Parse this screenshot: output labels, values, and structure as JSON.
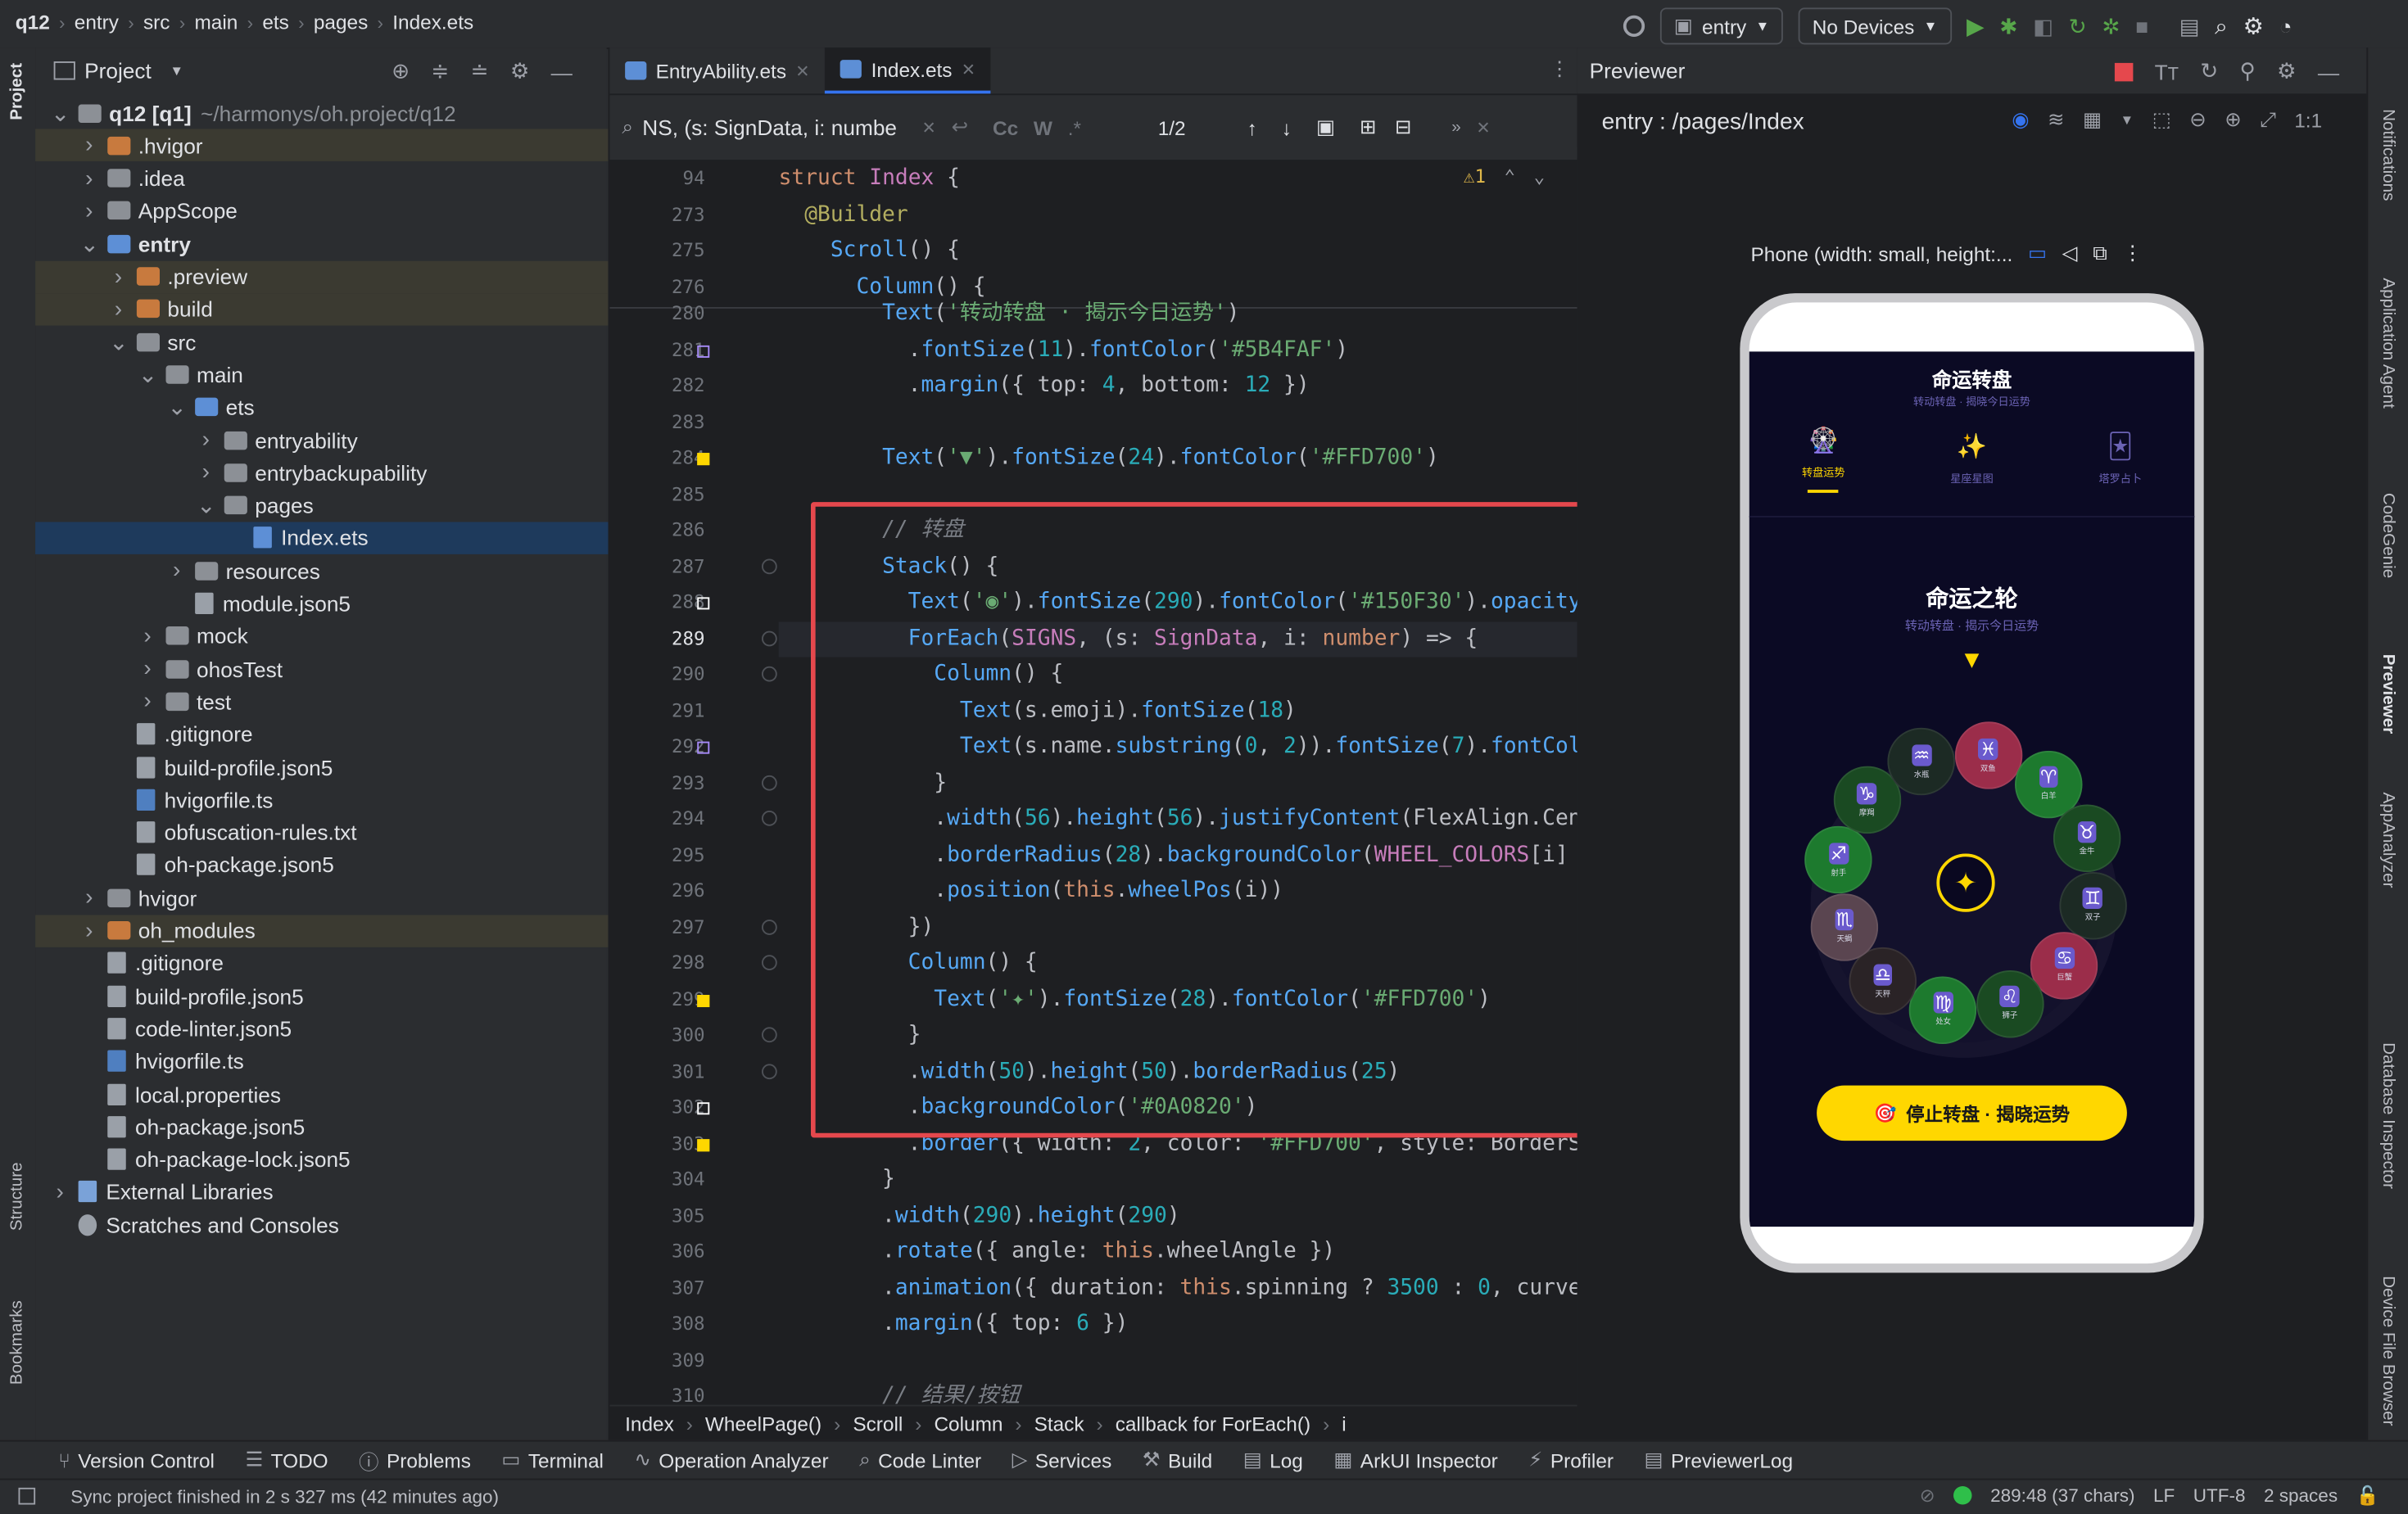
{
  "topbar": {
    "breadcrumbs": [
      "q12",
      "entry",
      "src",
      "main",
      "ets",
      "pages",
      "Index.ets"
    ],
    "run_config": "entry",
    "device": "No Devices"
  },
  "left_strip": {
    "project": "Project",
    "structure": "Structure",
    "bookmarks": "Bookmarks"
  },
  "right_strip": [
    "Notifications",
    "Application Agent",
    "CodeGenie",
    "Previewer",
    "AppAnalyzer",
    "Database Inspector",
    "Device File Browser"
  ],
  "project_panel": {
    "title": "Project",
    "tree": [
      {
        "label": "q12 [q1]",
        "suffix": "~/harmonys/oh.project/q12",
        "depth": 0,
        "kind": "root",
        "chev": "v"
      },
      {
        "label": ".hvigor",
        "depth": 1,
        "kind": "folder-orange",
        "chev": ">",
        "hl": true
      },
      {
        "label": ".idea",
        "depth": 1,
        "kind": "folder",
        "chev": ">"
      },
      {
        "label": "AppScope",
        "depth": 1,
        "kind": "folder",
        "chev": ">"
      },
      {
        "label": "entry",
        "depth": 1,
        "kind": "folder-blue",
        "chev": "v",
        "bold": true
      },
      {
        "label": ".preview",
        "depth": 2,
        "kind": "folder-orange",
        "chev": ">",
        "hl": true
      },
      {
        "label": "build",
        "depth": 2,
        "kind": "folder-orange",
        "chev": ">",
        "hl": true
      },
      {
        "label": "src",
        "depth": 2,
        "kind": "folder",
        "chev": "v"
      },
      {
        "label": "main",
        "depth": 3,
        "kind": "folder",
        "chev": "v"
      },
      {
        "label": "ets",
        "depth": 4,
        "kind": "folder-blue",
        "chev": "v"
      },
      {
        "label": "entryability",
        "depth": 5,
        "kind": "folder",
        "chev": ">"
      },
      {
        "label": "entrybackupability",
        "depth": 5,
        "kind": "folder",
        "chev": ">"
      },
      {
        "label": "pages",
        "depth": 5,
        "kind": "folder",
        "chev": "v"
      },
      {
        "label": "Index.ets",
        "depth": 6,
        "kind": "file-ets",
        "chev": "",
        "sel": true
      },
      {
        "label": "resources",
        "depth": 4,
        "kind": "folder",
        "chev": ">"
      },
      {
        "label": "module.json5",
        "depth": 4,
        "kind": "file",
        "chev": ""
      },
      {
        "label": "mock",
        "depth": 3,
        "kind": "folder",
        "chev": ">"
      },
      {
        "label": "ohosTest",
        "depth": 3,
        "kind": "folder",
        "chev": ">"
      },
      {
        "label": "test",
        "depth": 3,
        "kind": "folder",
        "chev": ">"
      },
      {
        "label": ".gitignore",
        "depth": 2,
        "kind": "file",
        "chev": ""
      },
      {
        "label": "build-profile.json5",
        "depth": 2,
        "kind": "file",
        "chev": ""
      },
      {
        "label": "hvigorfile.ts",
        "depth": 2,
        "kind": "file-ts",
        "chev": ""
      },
      {
        "label": "obfuscation-rules.txt",
        "depth": 2,
        "kind": "file",
        "chev": ""
      },
      {
        "label": "oh-package.json5",
        "depth": 2,
        "kind": "file",
        "chev": ""
      },
      {
        "label": "hvigor",
        "depth": 1,
        "kind": "folder",
        "chev": ">"
      },
      {
        "label": "oh_modules",
        "depth": 1,
        "kind": "folder-orange",
        "chev": ">",
        "hl": true
      },
      {
        "label": ".gitignore",
        "depth": 1,
        "kind": "file",
        "chev": ""
      },
      {
        "label": "build-profile.json5",
        "depth": 1,
        "kind": "file",
        "chev": ""
      },
      {
        "label": "code-linter.json5",
        "depth": 1,
        "kind": "file",
        "chev": ""
      },
      {
        "label": "hvigorfile.ts",
        "depth": 1,
        "kind": "file-ts",
        "chev": ""
      },
      {
        "label": "local.properties",
        "depth": 1,
        "kind": "file",
        "chev": ""
      },
      {
        "label": "oh-package.json5",
        "depth": 1,
        "kind": "file",
        "chev": ""
      },
      {
        "label": "oh-package-lock.json5",
        "depth": 1,
        "kind": "file",
        "chev": ""
      },
      {
        "label": "External Libraries",
        "depth": 0,
        "kind": "lib",
        "chev": ">"
      },
      {
        "label": "Scratches and Consoles",
        "depth": 0,
        "kind": "scratch",
        "chev": ""
      }
    ]
  },
  "editor": {
    "tabs": [
      {
        "label": "EntryAbility.ets",
        "active": false
      },
      {
        "label": "Index.ets",
        "active": true
      }
    ],
    "search": {
      "query": "NS, (s: SignData, i: numbe",
      "count": "1/2"
    },
    "warning_count": "1",
    "sticky_lines": [
      {
        "no": "94",
        "html": "<span class='kw'>struct</span> <span class='typ'>Index</span> {"
      },
      {
        "no": "273",
        "html": "  <span class='ann'>@Builder</span>"
      },
      {
        "no": "275",
        "html": "    <span class='fn'>Scroll</span>() {"
      },
      {
        "no": "276",
        "html": "      <span class='fn'>Column</span>() {"
      }
    ],
    "lines": [
      {
        "no": "280",
        "html": "        <span class='fn'>Text</span>(<span class='str'>'转动转盘 · 揭示今日运势'</span>)"
      },
      {
        "no": "281",
        "html": "          .<span class='fn'>fontSize</span>(<span class='num'>11</span>).<span class='fn'>fontColor</span>(<span class='str'>'#5B4FAF'</span>)"
      },
      {
        "no": "282",
        "html": "          .<span class='fn'>margin</span>({ top: <span class='num'>4</span>, bottom: <span class='num'>12</span> })"
      },
      {
        "no": "283",
        "html": ""
      },
      {
        "no": "284",
        "html": "        <span class='fn'>Text</span>(<span class='str'>'▼'</span>).<span class='fn'>fontSize</span>(<span class='num'>24</span>).<span class='fn'>fontColor</span>(<span class='str'>'#FFD700'</span>)"
      },
      {
        "no": "285",
        "html": ""
      },
      {
        "no": "286",
        "html": "        <span class='cmt'>// 转盘</span>"
      },
      {
        "no": "287",
        "html": "        <span class='fn'>Stack</span>() {"
      },
      {
        "no": "288",
        "html": "          <span class='fn'>Text</span>(<span class='str'>'◉'</span>).<span class='fn'>fontSize</span>(<span class='num'>290</span>).<span class='fn'>fontColor</span>(<span class='str'>'#150F30'</span>).<span class='fn'>opacity</span>("
      },
      {
        "no": "289",
        "html": "          <span class='fn'>ForEach</span>(<span class='prop'>SIGNS</span>, (s: <span class='typ'>SignData</span>, i: <span class='kw'>number</span>) => {"
      },
      {
        "no": "290",
        "html": "            <span class='fn'>Column</span>() {"
      },
      {
        "no": "291",
        "html": "              <span class='fn'>Text</span>(s.emoji).<span class='fn'>fontSize</span>(<span class='num'>18</span>)"
      },
      {
        "no": "292",
        "html": "              <span class='fn'>Text</span>(s.name.<span class='fn'>substring</span>(<span class='num'>0</span>, <span class='num'>2</span>)).<span class='fn'>fontSize</span>(<span class='num'>7</span>).<span class='fn'>fontCol</span>"
      },
      {
        "no": "293",
        "html": "            }"
      },
      {
        "no": "294",
        "html": "            .<span class='fn'>width</span>(<span class='num'>56</span>).<span class='fn'>height</span>(<span class='num'>56</span>).<span class='fn'>justifyContent</span>(FlexAlign.Cent"
      },
      {
        "no": "295",
        "html": "            .<span class='fn'>borderRadius</span>(<span class='num'>28</span>).<span class='fn'>backgroundColor</span>(<span class='prop'>WHEEL_COLORS</span>[i] -"
      },
      {
        "no": "296",
        "html": "            .<span class='fn'>position</span>(<span class='kw'>this</span>.<span class='fn'>wheelPos</span>(i))"
      },
      {
        "no": "297",
        "html": "          })"
      },
      {
        "no": "298",
        "html": "          <span class='fn'>Column</span>() {"
      },
      {
        "no": "299",
        "html": "            <span class='fn'>Text</span>(<span class='str'>'✦'</span>).<span class='fn'>fontSize</span>(<span class='num'>28</span>).<span class='fn'>fontColor</span>(<span class='str'>'#FFD700'</span>)"
      },
      {
        "no": "300",
        "html": "          }"
      },
      {
        "no": "301",
        "html": "          .<span class='fn'>width</span>(<span class='num'>50</span>).<span class='fn'>height</span>(<span class='num'>50</span>).<span class='fn'>borderRadius</span>(<span class='num'>25</span>)"
      },
      {
        "no": "302",
        "html": "          .<span class='fn'>backgroundColor</span>(<span class='str'>'#0A0820'</span>)"
      },
      {
        "no": "303",
        "html": "          .<span class='fn'>border</span>({ width: <span class='num'>2</span>, color: <span class='str'>'#FFD700'</span>, style: BorderSt"
      },
      {
        "no": "304",
        "html": "        }"
      },
      {
        "no": "305",
        "html": "        .<span class='fn'>width</span>(<span class='num'>290</span>).<span class='fn'>height</span>(<span class='num'>290</span>)"
      },
      {
        "no": "306",
        "html": "        .<span class='fn'>rotate</span>({ angle: <span class='kw'>this</span>.wheelAngle })"
      },
      {
        "no": "307",
        "html": "        .<span class='fn'>animation</span>({ duration: <span class='kw'>this</span>.spinning ? <span class='num'>3500</span> : <span class='num'>0</span>, curve:"
      },
      {
        "no": "308",
        "html": "        .<span class='fn'>margin</span>({ top: <span class='num'>6</span> })"
      },
      {
        "no": "309",
        "html": ""
      },
      {
        "no": "310",
        "html": "        <span class='cmt'>// 结果/按钮</span>"
      }
    ],
    "breadcrumb": [
      "Index",
      "WheelPage()",
      "Scroll",
      "Column",
      "Stack",
      "callback for ForEach()",
      "i"
    ]
  },
  "previewer": {
    "title": "Previewer",
    "route": "entry : /pages/Index",
    "device_label": "Phone (width: small, height:...",
    "app": {
      "title": "命运转盘",
      "subtitle": "转动转盘 · 揭晓今日运势",
      "tabs": [
        {
          "label": "转盘运势",
          "icon": "🎡"
        },
        {
          "label": "星座星图",
          "icon": "✨"
        },
        {
          "label": "塔罗占卜",
          "icon": "🃏"
        }
      ],
      "wheel_title": "命运之轮",
      "wheel_subtitle": "转动转盘 · 揭示今日运势",
      "pointer": "▼",
      "center": "✦",
      "signs": [
        {
          "sym": "♓",
          "name": "双鱼",
          "color": "#9b2d4a"
        },
        {
          "sym": "♈",
          "name": "白羊",
          "color": "#1d7a2e"
        },
        {
          "sym": "♉",
          "name": "金牛",
          "color": "#1a4a22"
        },
        {
          "sym": "♊",
          "name": "双子",
          "color": "#1c2a24"
        },
        {
          "sym": "♋",
          "name": "巨蟹",
          "color": "#9b2d4a"
        },
        {
          "sym": "♌",
          "name": "狮子",
          "color": "#1a4a22"
        },
        {
          "sym": "♍",
          "name": "处女",
          "color": "#1d7a2e"
        },
        {
          "sym": "♎",
          "name": "天秤",
          "color": "#2a2326"
        },
        {
          "sym": "♏",
          "name": "天蝎",
          "color": "#5a4550"
        },
        {
          "sym": "♐",
          "name": "射手",
          "color": "#1d7a2e"
        },
        {
          "sym": "♑",
          "name": "摩羯",
          "color": "#1a4a22"
        },
        {
          "sym": "♒",
          "name": "水瓶",
          "color": "#1c2a24"
        }
      ],
      "button": "停止转盘 · 揭晓运势",
      "button_icon": "🎯"
    }
  },
  "bottom_tools": [
    "Version Control",
    "TODO",
    "Problems",
    "Terminal",
    "Operation Analyzer",
    "Code Linter",
    "Services",
    "Build",
    "Log",
    "ArkUI Inspector",
    "Profiler",
    "PreviewerLog"
  ],
  "status": {
    "message": "Sync project finished in 2 s 327 ms (42 minutes ago)",
    "position": "289:48 (37 chars)",
    "line_sep": "LF",
    "encoding": "UTF-8",
    "indent": "2 spaces"
  },
  "colors": {
    "highlight_box": "#e5484d",
    "accent_yellow": "#FFD700",
    "selection": "#1e3a5c"
  }
}
